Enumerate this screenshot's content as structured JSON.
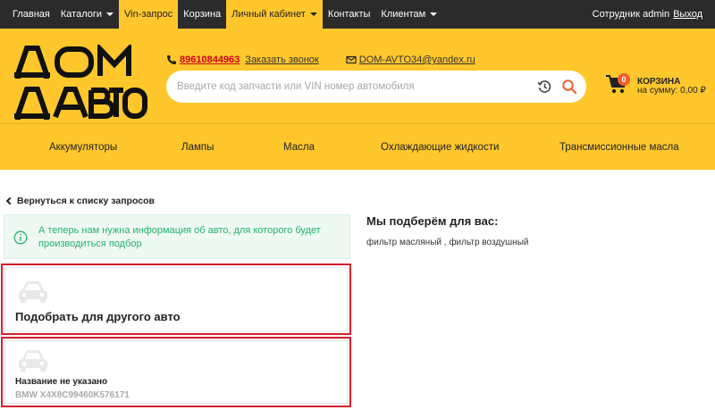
{
  "topnav": {
    "items": [
      {
        "label": "Главная"
      },
      {
        "label": "Каталоги"
      },
      {
        "label": "Vin-запрос"
      },
      {
        "label": "Корзина"
      },
      {
        "label": "Личный кабинет"
      },
      {
        "label": "Контакты"
      },
      {
        "label": "Клиентам"
      }
    ],
    "user_label": "Сотрудник admin",
    "logout_label": "Выход"
  },
  "header": {
    "logo_line1": "ДОМ",
    "logo_line2": "АВТО",
    "phone": "89610844963",
    "callback_label": "Заказать звонок",
    "email": "DOM-AVTO34@yandex.ru",
    "search_placeholder": "Введите код запчасти или VIN номер автомобиля",
    "search_value": "",
    "cart_count": "0",
    "cart_label": "КОРЗИНА",
    "cart_sum": "на сумму: 0,00 ₽"
  },
  "categories": [
    {
      "label": "Аккумуляторы"
    },
    {
      "label": "Лампы"
    },
    {
      "label": "Масла"
    },
    {
      "label": "Охлаждающие жидкости"
    },
    {
      "label": "Трансмиссионные масла"
    }
  ],
  "main": {
    "back_label": "Вернуться к списку запросов",
    "info_text": "А теперь нам нужна информация об авто, для которого будет производиться подбор",
    "card_other_title": "Подобрать для другого авто",
    "card_car_title": "Название не указано",
    "card_car_vin": "BMW X4X8C99460K576171",
    "picks_title": "Мы подберём для вас:",
    "picks_text": "фильтр масляный , фильтр воздушный"
  },
  "colors": {
    "accent_yellow": "#ffc72c",
    "nav_dark": "#2b2b2b",
    "highlight_red": "#d61f2c",
    "info_green": "#27b06e",
    "badge_orange": "#f45d28"
  },
  "icons": [
    "phone-icon",
    "mail-icon",
    "history-icon",
    "search-icon",
    "cart-icon",
    "info-icon",
    "car-icon",
    "chevron-left-icon",
    "caret-down-icon"
  ]
}
